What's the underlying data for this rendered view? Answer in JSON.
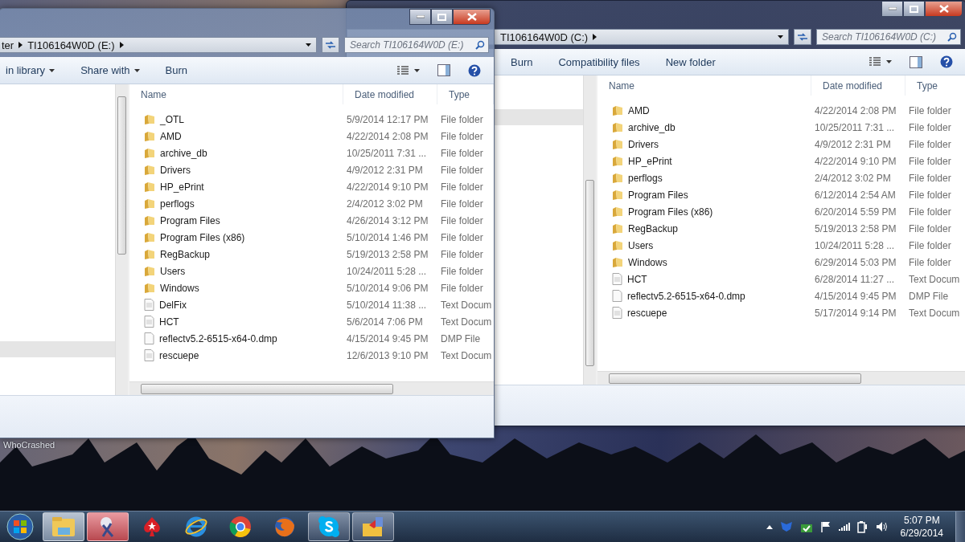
{
  "desktop": {
    "icon_label": "WhoCrashed"
  },
  "windows": [
    {
      "address": [
        "TI106164W0D (C:)"
      ],
      "search": {
        "placeholder": "Search TI106164W0D (C:)"
      },
      "toolbar": [
        {
          "label": "Burn",
          "dropdown": false
        },
        {
          "label": "Compatibility files",
          "dropdown": false
        },
        {
          "label": "New folder",
          "dropdown": false
        }
      ],
      "columns": [
        "Name",
        "Date modified",
        "Type"
      ],
      "files": [
        {
          "kind": "folder",
          "name": "AMD",
          "date": "4/22/2014 2:08 PM",
          "type": "File folder"
        },
        {
          "kind": "folder",
          "name": "archive_db",
          "date": "10/25/2011 7:31 ...",
          "type": "File folder"
        },
        {
          "kind": "folder",
          "name": "Drivers",
          "date": "4/9/2012 2:31 PM",
          "type": "File folder"
        },
        {
          "kind": "folder",
          "name": "HP_ePrint",
          "date": "4/22/2014 9:10 PM",
          "type": "File folder"
        },
        {
          "kind": "folder",
          "name": "perflogs",
          "date": "2/4/2012 3:02 PM",
          "type": "File folder"
        },
        {
          "kind": "folder",
          "name": "Program Files",
          "date": "6/12/2014 2:54 AM",
          "type": "File folder"
        },
        {
          "kind": "folder",
          "name": "Program Files (x86)",
          "date": "6/20/2014 5:59 PM",
          "type": "File folder"
        },
        {
          "kind": "folder",
          "name": "RegBackup",
          "date": "5/19/2013 2:58 PM",
          "type": "File folder"
        },
        {
          "kind": "folder",
          "name": "Users",
          "date": "10/24/2011 5:28 ...",
          "type": "File folder"
        },
        {
          "kind": "folder",
          "name": "Windows",
          "date": "6/29/2014 5:03 PM",
          "type": "File folder"
        },
        {
          "kind": "text",
          "name": "HCT",
          "date": "6/28/2014 11:27 ...",
          "type": "Text Docum"
        },
        {
          "kind": "blank",
          "name": "reflectv5.2-6515-x64-0.dmp",
          "date": "4/15/2014 9:45 PM",
          "type": "DMP File"
        },
        {
          "kind": "text",
          "name": "rescuepe",
          "date": "5/17/2014 9:14 PM",
          "type": "Text Docum"
        }
      ]
    },
    {
      "address": [
        "ter",
        "TI106164W0D (E:)"
      ],
      "search": {
        "placeholder": "Search TI106164W0D (E:)"
      },
      "toolbar": [
        {
          "label": "in library",
          "dropdown": true
        },
        {
          "label": "Share with",
          "dropdown": true
        },
        {
          "label": "Burn",
          "dropdown": false
        }
      ],
      "columns": [
        "Name",
        "Date modified",
        "Type"
      ],
      "files": [
        {
          "kind": "folder",
          "name": "_OTL",
          "date": "5/9/2014 12:17 PM",
          "type": "File folder"
        },
        {
          "kind": "folder",
          "name": "AMD",
          "date": "4/22/2014 2:08 PM",
          "type": "File folder"
        },
        {
          "kind": "folder",
          "name": "archive_db",
          "date": "10/25/2011 7:31 ...",
          "type": "File folder"
        },
        {
          "kind": "folder",
          "name": "Drivers",
          "date": "4/9/2012 2:31 PM",
          "type": "File folder"
        },
        {
          "kind": "folder",
          "name": "HP_ePrint",
          "date": "4/22/2014 9:10 PM",
          "type": "File folder"
        },
        {
          "kind": "folder",
          "name": "perflogs",
          "date": "2/4/2012 3:02 PM",
          "type": "File folder"
        },
        {
          "kind": "folder",
          "name": "Program Files",
          "date": "4/26/2014 3:12 PM",
          "type": "File folder"
        },
        {
          "kind": "folder",
          "name": "Program Files (x86)",
          "date": "5/10/2014 1:46 PM",
          "type": "File folder"
        },
        {
          "kind": "folder",
          "name": "RegBackup",
          "date": "5/19/2013 2:58 PM",
          "type": "File folder"
        },
        {
          "kind": "folder",
          "name": "Users",
          "date": "10/24/2011 5:28 ...",
          "type": "File folder"
        },
        {
          "kind": "folder",
          "name": "Windows",
          "date": "5/10/2014 9:06 PM",
          "type": "File folder"
        },
        {
          "kind": "text",
          "name": "DelFix",
          "date": "5/10/2014 11:38 ...",
          "type": "Text Docum"
        },
        {
          "kind": "text",
          "name": "HCT",
          "date": "5/6/2014 7:06 PM",
          "type": "Text Docum"
        },
        {
          "kind": "blank",
          "name": "reflectv5.2-6515-x64-0.dmp",
          "date": "4/15/2014 9:45 PM",
          "type": "DMP File"
        },
        {
          "kind": "text",
          "name": "rescuepe",
          "date": "12/6/2013 9:10 PM",
          "type": "Text Docum"
        }
      ]
    }
  ],
  "taskbar": {
    "apps": [
      {
        "kind": "explorer",
        "active": true
      },
      {
        "kind": "snipping",
        "active": true
      },
      {
        "kind": "poker",
        "active": false
      },
      {
        "kind": "ie",
        "active": false
      },
      {
        "kind": "chrome",
        "active": false
      },
      {
        "kind": "firefox",
        "active": false
      },
      {
        "kind": "skype",
        "active": true
      },
      {
        "kind": "folderapp",
        "active": true
      }
    ],
    "time": "5:07 PM",
    "date": "6/29/2014"
  }
}
